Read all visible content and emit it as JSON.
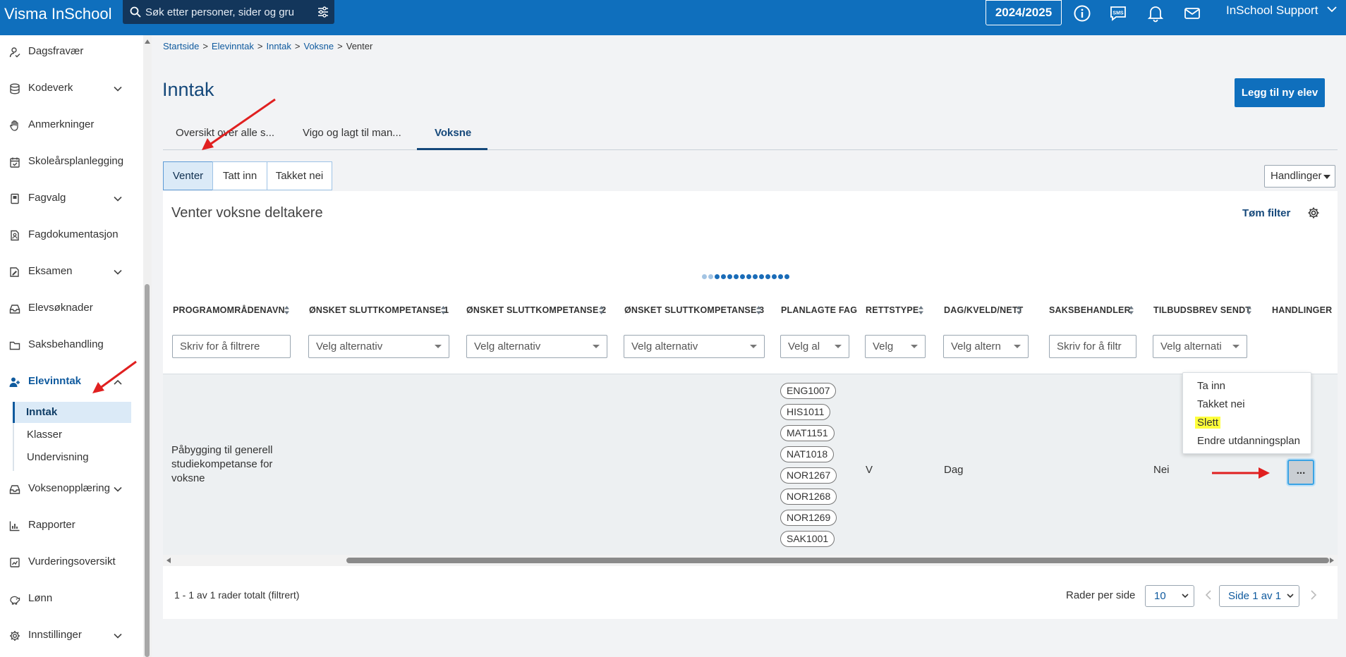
{
  "app": {
    "title": "Visma InSchool"
  },
  "header": {
    "search_placeholder": "Søk etter personer, sider og gru",
    "school_year": "2024/2025",
    "user_name": "InSchool Support"
  },
  "sidebar": {
    "items": [
      {
        "label": "Dagsfravær",
        "icon": "person-check-icon",
        "expandable": false
      },
      {
        "label": "Kodeverk",
        "icon": "database-icon",
        "expandable": true
      },
      {
        "label": "Anmerkninger",
        "icon": "hand-icon",
        "expandable": false
      },
      {
        "label": "Skoleårsplanlegging",
        "icon": "calendar-check-icon",
        "expandable": false
      },
      {
        "label": "Fagvalg",
        "icon": "book-icon",
        "expandable": true
      },
      {
        "label": "Fagdokumentasjon",
        "icon": "person-doc-icon",
        "expandable": false
      },
      {
        "label": "Eksamen",
        "icon": "exam-icon",
        "expandable": true
      },
      {
        "label": "Elevsøknader",
        "icon": "inbox-icon",
        "expandable": false
      },
      {
        "label": "Saksbehandling",
        "icon": "folder-icon",
        "expandable": false
      },
      {
        "label": "Elevinntak",
        "icon": "person-add-icon",
        "expandable": true,
        "active": true
      },
      {
        "label": "Voksenopplæring",
        "icon": "inbox-icon",
        "expandable": true
      },
      {
        "label": "Rapporter",
        "icon": "bar-chart-icon",
        "expandable": false
      },
      {
        "label": "Vurderingsoversikt",
        "icon": "assessment-icon",
        "expandable": false
      },
      {
        "label": "Lønn",
        "icon": "piggy-bank-icon",
        "expandable": false
      },
      {
        "label": "Innstillinger",
        "icon": "gear-icon",
        "expandable": true
      }
    ],
    "subitems": [
      {
        "label": "Inntak",
        "active": true
      },
      {
        "label": "Klasser"
      },
      {
        "label": "Undervisning"
      }
    ]
  },
  "breadcrumbs": [
    "Startside",
    "Elevinntak",
    "Inntak",
    "Voksne",
    "Venter"
  ],
  "page": {
    "title": "Inntak",
    "add_button": "Legg til ny elev"
  },
  "tabs": [
    {
      "label": "Oversikt over alle s..."
    },
    {
      "label": "Vigo og lagt til man..."
    },
    {
      "label": "Voksne",
      "active": true
    }
  ],
  "segments": [
    {
      "label": "Venter",
      "active": true
    },
    {
      "label": "Tatt inn"
    },
    {
      "label": "Takket nei"
    }
  ],
  "actions_button": "Handlinger",
  "panel": {
    "title": "Venter voksne deltakere",
    "clear_filter": "Tøm filter"
  },
  "table": {
    "columns": [
      {
        "header": "PROGRAMOMRÅDENAVN",
        "filter": "Skriv for å filtrere",
        "filter_type": "text"
      },
      {
        "header": "ØNSKET SLUTTKOMPETANSE 1",
        "filter": "Velg alternativ",
        "filter_type": "select"
      },
      {
        "header": "ØNSKET SLUTTKOMPETANSE 2",
        "filter": "Velg alternativ",
        "filter_type": "select"
      },
      {
        "header": "ØNSKET SLUTTKOMPETANSE 3",
        "filter": "Velg alternativ",
        "filter_type": "select"
      },
      {
        "header": "PLANLAGTE FAG",
        "filter": "Velg al",
        "filter_type": "select"
      },
      {
        "header": "RETTSTYPE",
        "filter": "Velg",
        "filter_type": "select"
      },
      {
        "header": "DAG/KVELD/NETT",
        "filter": "Velg altern",
        "filter_type": "select"
      },
      {
        "header": "SAKSBEHANDLER",
        "filter": "Skriv for å filtr",
        "filter_type": "text"
      },
      {
        "header": "TILBUDSBREV SENDT",
        "filter": "Velg alternati",
        "filter_type": "select"
      },
      {
        "header": "HANDLINGER"
      }
    ],
    "rows": [
      {
        "program": "Påbygging til generell studiekompetanse for voksne",
        "subjects": [
          "ENG1007",
          "HIS1011",
          "MAT1151",
          "NAT1018",
          "NOR1267",
          "NOR1268",
          "NOR1269",
          "SAK1001"
        ],
        "rettstype": "V",
        "dag": "Dag",
        "tilbudsbrev": "Nei",
        "actions_label": "..."
      }
    ]
  },
  "row_menu": {
    "items": [
      "Ta inn",
      "Takket nei",
      "Slett",
      "Endre utdanningsplan"
    ],
    "highlighted": "Slett"
  },
  "footer": {
    "info": "1 - 1 av 1 rader totalt (filtrert)",
    "rows_per_page_label": "Rader per side",
    "rows_per_page": "10",
    "page": "Side 1 av 1"
  },
  "colors": {
    "brand": "#0f6fbd",
    "title": "#15487a",
    "highlight": "#ffff3b",
    "annotation_arrow": "#e02020"
  }
}
